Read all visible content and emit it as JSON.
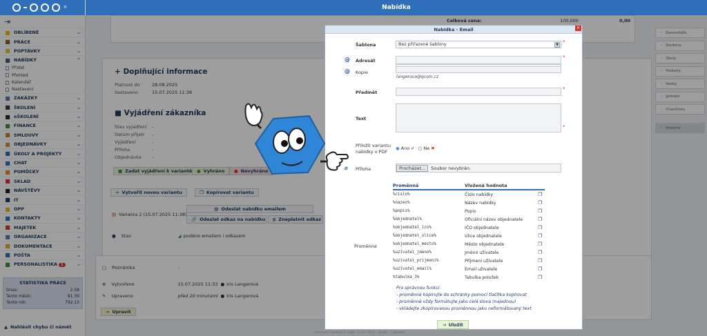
{
  "header": {
    "title": "Nabídka"
  },
  "sidebar": {
    "logout_icon": "logout-icon",
    "items": [
      {
        "label": "OBLÍBENÉ",
        "icon": "star-icon",
        "color": "#f1b51c"
      },
      {
        "label": "PRÁCE",
        "icon": "briefcase-icon",
        "color": "#8b5a2b"
      },
      {
        "label": "POPTÁVKY",
        "icon": "lightbulb-icon",
        "color": "#e7c02c"
      },
      {
        "label": "NABÍDKY",
        "icon": "handshake-icon",
        "color": "#4b5b73"
      },
      {
        "label": "ZAKÁZKY",
        "icon": "folder-icon",
        "color": "#5a7ba8"
      },
      {
        "label": "ŠKOLENÍ",
        "icon": "board-icon",
        "color": "#3a3a3a"
      },
      {
        "label": "eŠKOLENÍ",
        "icon": "graduation-icon",
        "color": "#2a2a2a"
      },
      {
        "label": "FINANCE",
        "icon": "money-icon",
        "color": "#3e8f3e"
      },
      {
        "label": "SMLOUVY",
        "icon": "handshake-icon",
        "color": "#c0842e"
      },
      {
        "label": "OBJEDNÁVKY",
        "icon": "box-icon",
        "color": "#c59a3a"
      },
      {
        "label": "ÚKOLY A PROJEKTY",
        "icon": "checklist-icon",
        "color": "#2f6fb9"
      },
      {
        "label": "CHAT",
        "icon": "chat-icon",
        "color": "#2f6fb9"
      },
      {
        "label": "POMŮCKY",
        "icon": "tools-icon",
        "color": "#e38b1f"
      },
      {
        "label": "SKLAD",
        "icon": "warehouse-icon",
        "color": "#d9342b"
      },
      {
        "label": "NÁVŠTĚVY",
        "icon": "walker-icon",
        "color": "#222"
      },
      {
        "label": "IT",
        "icon": "monitor-icon",
        "color": "#1f3a63"
      },
      {
        "label": "OPP",
        "icon": "helmet-icon",
        "color": "#f1b51c"
      },
      {
        "label": "KONTAKTY",
        "icon": "contacts-icon",
        "color": "#2f6fb9"
      },
      {
        "label": "MAJETEK",
        "icon": "car-icon",
        "color": "#d9342b"
      },
      {
        "label": "ORGANIZACE",
        "icon": "org-icon",
        "color": "#5a7ba8"
      },
      {
        "label": "DOKUMENTACE",
        "icon": "document-icon",
        "color": "#e0a82a"
      },
      {
        "label": "POŠTA",
        "icon": "mail-icon",
        "color": "#2f6fb9"
      },
      {
        "label": "PERSONALISTIKA",
        "icon": "people-icon",
        "color": "#3e8f3e",
        "badge": "1"
      }
    ],
    "sub_items": [
      "Přidat",
      "Přehled",
      "Kalendář",
      "Nastavení"
    ],
    "stats": {
      "title": "STATISTIKA PRÁCE",
      "rows": [
        {
          "label": "Dnes:",
          "value": "2.58"
        },
        {
          "label": "Tento měsíc:",
          "value": "81.30"
        },
        {
          "label": "Tento rok:",
          "value": "792.13"
        }
      ]
    },
    "report": "Nahlásit chybu či námět"
  },
  "main": {
    "total_label": "Celková cena:",
    "total_value": "100,000",
    "total_value2": "0,00",
    "info": {
      "title": "+ Doplňující informace",
      "rows": [
        {
          "k": "Platnost do",
          "v": "28.08.2025"
        },
        {
          "k": "Sestaveno",
          "v": "15.07.2025 11:38"
        }
      ]
    },
    "customer": {
      "title": "Vyjádření zákazníka",
      "rows": [
        {
          "k": "Stav vyjádření",
          "v": "-"
        },
        {
          "k": "Datum přijetí",
          "v": "-"
        },
        {
          "k": "Vyjádření",
          "v": "-"
        },
        {
          "k": "Příloha",
          "v": "-"
        },
        {
          "k": "Objednávka",
          "v": "-"
        }
      ],
      "buttons": [
        "Zadat vyjádření k variantě",
        "Vyhráno",
        "Nevyhráno"
      ]
    },
    "variant_buttons": [
      "Vytvořit novou variantu",
      "Kopírovat variantu"
    ],
    "variant": {
      "label": "Varianta 2 (15.07.2025 11:38)",
      "send_email": "Odeslat nabídku emailem",
      "send_link": "Odeslat odkaz na nabídku",
      "invalidate": "Zneplatnit odkaz",
      "status_label": "Stav",
      "status_value": "podáno emailem i odkazem"
    },
    "meta": {
      "note_label": "Poznámka",
      "note_value": "-",
      "created_label": "Vytvořeno",
      "created_value": "15.07.2025 11:33",
      "created_by": "Iris Langerová",
      "edited_label": "Upraveno",
      "edited_value": "před 20 minutami",
      "edited_by": "Iris Langerová",
      "edit_button": "Upravit"
    }
  },
  "right_panel": [
    "Komentáře",
    "Soubory",
    "Úkoly",
    "Podsety",
    "Vazby",
    "Jednání",
    "Checklisty",
    "Historie"
  ],
  "modal": {
    "title": "Nabídka - Email",
    "template_label": "Šablona",
    "template_value": "Bez přiřazené šablony",
    "to_label": "Adresát",
    "copy_label": "Kopie",
    "copy_hint": "langerova@qcom.cz",
    "subject_label": "Předmět",
    "text_label": "Text",
    "attach_pdf_label": "Přiložit variantu nabídky v PDF",
    "yes": "Ano",
    "no": "Ne",
    "attachment_label": "Příloha",
    "browse": "Procházet...",
    "no_file": "Soubor nevybrán.",
    "variables_label": "Proměnné",
    "var_head": [
      "Proměnná",
      "Vložená hodnota"
    ],
    "variables": [
      {
        "var": "%cislo%",
        "value": "Číslo nabídky"
      },
      {
        "var": "%nazev%",
        "value": "Název nabídky"
      },
      {
        "var": "%popis%",
        "value": "Popis"
      },
      {
        "var": "%objednatel%",
        "value": "Oficiální název objednatele"
      },
      {
        "var": "%objednatel_ico%",
        "value": "IČO objednatele"
      },
      {
        "var": "%objednatel_ulice%",
        "value": "Ulice objednatele"
      },
      {
        "var": "%objednatel_mesto%",
        "value": "Město objednatele"
      },
      {
        "var": "%uzivatel_jmeno%",
        "value": "Jméno uživatele"
      },
      {
        "var": "%uzivatel_prijmeni%",
        "value": "Příjmení uživatele"
      },
      {
        "var": "%uzivatel_email%",
        "value": "Email uživatele"
      },
      {
        "var": "%tabulka_3%",
        "value": "Tabulka položek"
      }
    ],
    "notes": [
      "Pro správnou funkci",
      "- proměnné kopírujte do schránky pomocí tlačítka kopírovat",
      "- proměnné vždy formátujte jako celá slova (najednou)",
      "- vkládejte zkopírovanou proměnnou jako neformátovaný text"
    ],
    "save": "Uložit"
  },
  "footer_text": "Informační systém Q-COM · 15.07.2025 · 12:02 · 1 uživatel"
}
